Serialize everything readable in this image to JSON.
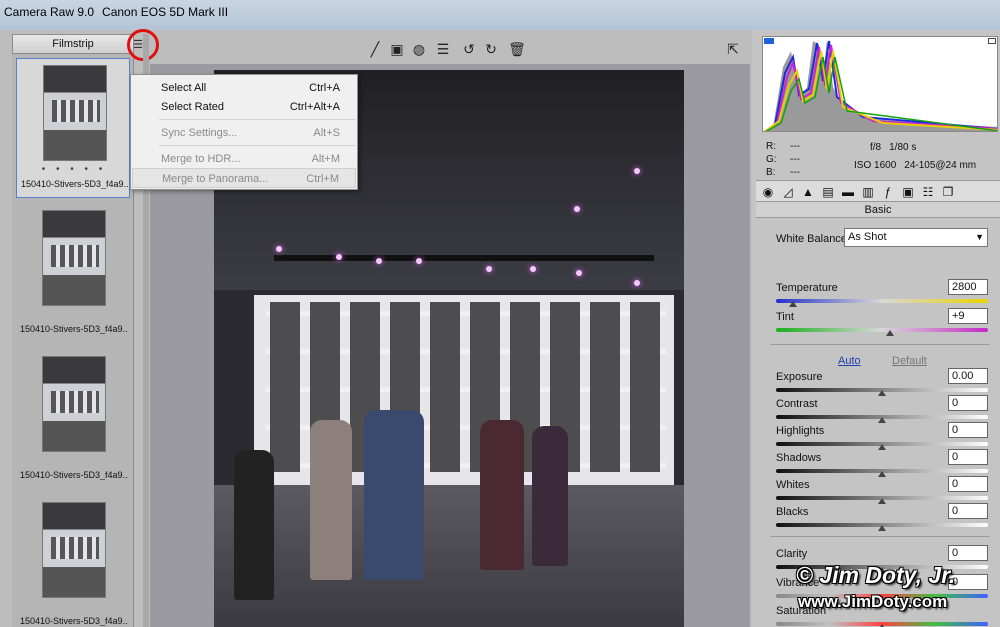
{
  "window": {
    "title": "Camera Raw 9.0",
    "camera": "Canon EOS 5D Mark III"
  },
  "filmstrip": {
    "header": "Filmstrip",
    "menu_icon": "list-menu-icon",
    "thumbs": [
      {
        "name": "150410-Stivers-5D3_f4a9...",
        "rating": "• • • • •",
        "selected": true
      },
      {
        "name": "150410-Stivers-5D3_f4a9...",
        "rating": "",
        "selected": false
      },
      {
        "name": "150410-Stivers-5D3_f4a9...",
        "rating": "",
        "selected": false
      },
      {
        "name": "150410-Stivers-5D3_f4a9...",
        "rating": "",
        "selected": false
      }
    ]
  },
  "menu": {
    "items": [
      {
        "label": "Select All",
        "shortcut": "Ctrl+A",
        "enabled": true
      },
      {
        "label": "Select Rated",
        "shortcut": "Ctrl+Alt+A",
        "enabled": true
      },
      {
        "label": "Sync Settings...",
        "shortcut": "Alt+S",
        "enabled": false
      },
      {
        "label": "Merge to HDR...",
        "shortcut": "Alt+M",
        "enabled": false
      },
      {
        "label": "Merge to Panorama...",
        "shortcut": "Ctrl+M",
        "enabled": false
      }
    ]
  },
  "toolbar": {
    "icons": [
      "brush-icon",
      "gradient-icon",
      "radial-filter-icon",
      "list-icon",
      "rotate-left-icon",
      "rotate-right-icon",
      "trash-icon",
      "fullscreen-icon"
    ]
  },
  "info": {
    "r_label": "R:",
    "r_value": "---",
    "g_label": "G:",
    "g_value": "---",
    "b_label": "B:",
    "b_value": "---",
    "aperture": "f/8",
    "shutter": "1/80 s",
    "iso": "ISO 1600",
    "lens": "24-105@24 mm"
  },
  "panel": {
    "title": "Basic",
    "white_balance_label": "White Balance:",
    "white_balance_value": "As Shot",
    "auto_label": "Auto",
    "default_label": "Default",
    "sliders": [
      {
        "key": "temperature",
        "label": "Temperature",
        "value": "2800",
        "position": 0.08
      },
      {
        "key": "tint",
        "label": "Tint",
        "value": "+9",
        "position": 0.54
      },
      {
        "key": "exposure",
        "label": "Exposure",
        "value": "0.00",
        "position": 0.5
      },
      {
        "key": "contrast",
        "label": "Contrast",
        "value": "0",
        "position": 0.5
      },
      {
        "key": "highlights",
        "label": "Highlights",
        "value": "0",
        "position": 0.5
      },
      {
        "key": "shadows",
        "label": "Shadows",
        "value": "0",
        "position": 0.5
      },
      {
        "key": "whites",
        "label": "Whites",
        "value": "0",
        "position": 0.5
      },
      {
        "key": "blacks",
        "label": "Blacks",
        "value": "0",
        "position": 0.5
      },
      {
        "key": "clarity",
        "label": "Clarity",
        "value": "0",
        "position": 0.5
      },
      {
        "key": "vibrance",
        "label": "Vibrance",
        "value": "0",
        "position": 0.5
      },
      {
        "key": "saturation",
        "label": "Saturation",
        "value": "",
        "position": 0.5
      }
    ]
  },
  "watermark": {
    "line1": "© Jim Doty, Jr.",
    "line2": "www.JimDoty.com"
  },
  "colors": {
    "accent": "#1f3fae",
    "circle": "#e01010",
    "selection": "#5b7ec8"
  }
}
